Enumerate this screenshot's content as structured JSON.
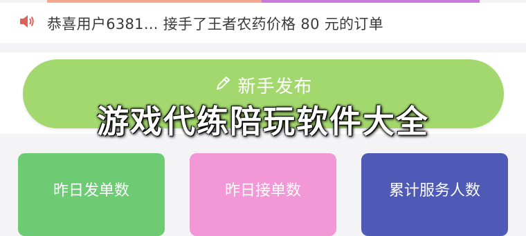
{
  "notice": {
    "icon": "speaker-icon",
    "text": "恭喜用户6381... 接手了王者农药价格 80 元的订单"
  },
  "publish": {
    "icon": "pencil-icon",
    "label": "新手发布"
  },
  "overlay_title": "游戏代练陪玩软件大全",
  "stats": [
    {
      "label": "昨日发单数",
      "value": ""
    },
    {
      "label": "昨日接单数",
      "value": ""
    },
    {
      "label": "累计服务人数",
      "value": ""
    }
  ],
  "colors": {
    "publish_button": "#a3d86e",
    "card_1": "#6dcb73",
    "card_2": "#f398d7",
    "card_3": "#4f59b6",
    "speaker": "#e0605a"
  }
}
